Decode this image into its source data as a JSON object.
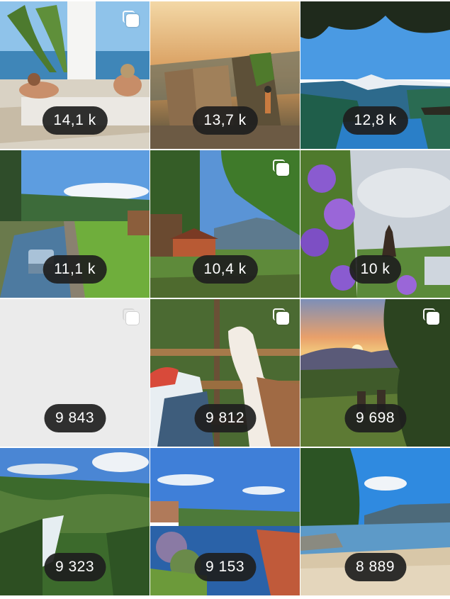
{
  "grid": {
    "tiles": [
      {
        "views": "14,1 k",
        "multi": true,
        "scene": "beach-sunbathers"
      },
      {
        "views": "13,7 k",
        "multi": false,
        "scene": "cliff-sunset"
      },
      {
        "views": "12,8 k",
        "multi": false,
        "scene": "fjord-mountains"
      },
      {
        "views": "11,1 k",
        "multi": false,
        "scene": "car-canal"
      },
      {
        "views": "10,4 k",
        "multi": true,
        "scene": "forest-cabin"
      },
      {
        "views": "10 k",
        "multi": false,
        "scene": "lilac-stave-church"
      },
      {
        "views": "9 843",
        "multi": true,
        "scene": "blank"
      },
      {
        "views": "9 812",
        "multi": true,
        "scene": "boy-llama"
      },
      {
        "views": "9 698",
        "multi": true,
        "scene": "sunset-meadow"
      },
      {
        "views": "9 323",
        "multi": false,
        "scene": "waterfall-valley"
      },
      {
        "views": "9 153",
        "multi": false,
        "scene": "town-canal"
      },
      {
        "views": "8 889",
        "multi": false,
        "scene": "lake-beach"
      }
    ]
  }
}
